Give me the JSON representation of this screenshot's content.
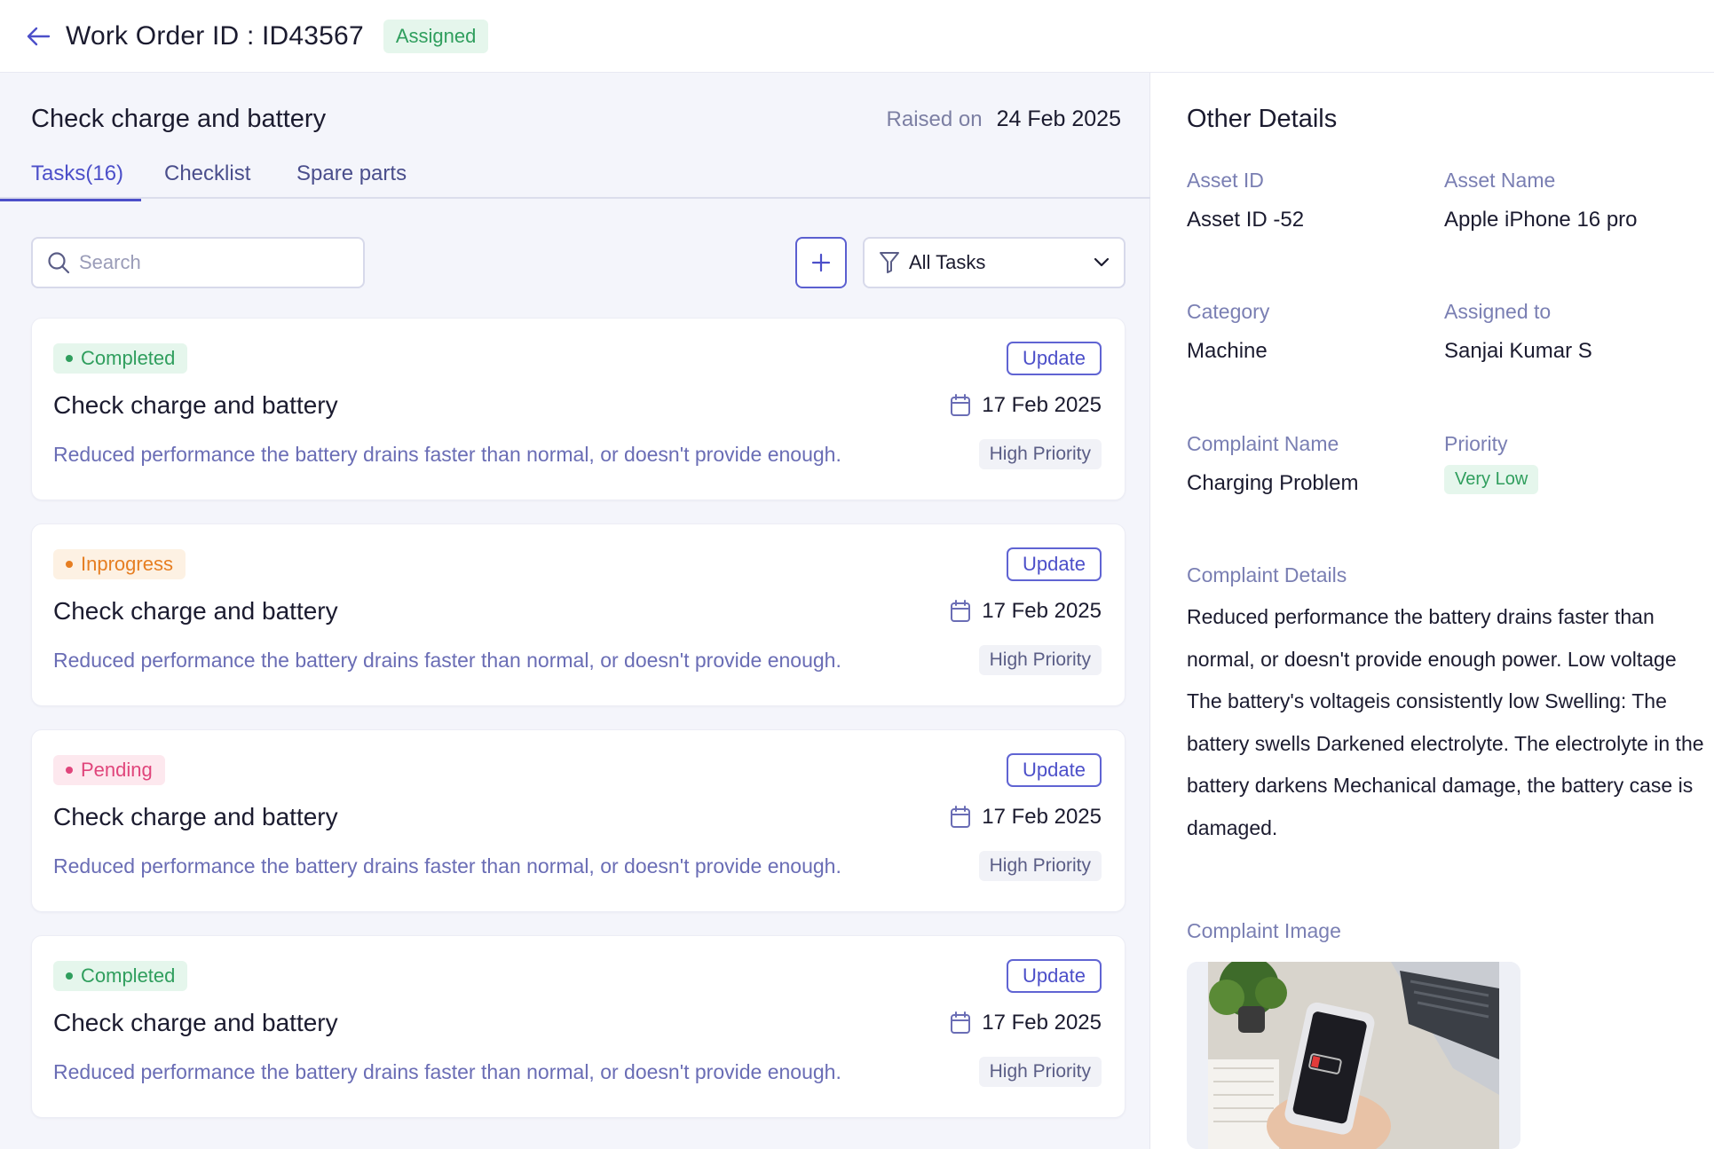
{
  "header": {
    "title": "Work Order ID : ID43567",
    "status": "Assigned"
  },
  "work_order": {
    "title": "Check charge and battery",
    "raised_label": "Raised on",
    "raised_date": "24 Feb 2025"
  },
  "tabs": [
    {
      "label": "Tasks(16)",
      "active": true
    },
    {
      "label": "Checklist",
      "active": false
    },
    {
      "label": "Spare parts",
      "active": false
    }
  ],
  "toolbar": {
    "search_placeholder": "Search",
    "filter_label": "All Tasks"
  },
  "tasks": [
    {
      "status": "Completed",
      "update_label": "Update",
      "title": "Check charge and battery",
      "date": "17 Feb 2025",
      "description": "Reduced performance the battery drains faster than normal, or doesn't provide enough.",
      "priority": "High Priority"
    },
    {
      "status": "Inprogress",
      "update_label": "Update",
      "title": "Check charge and battery",
      "date": "17 Feb 2025",
      "description": "Reduced performance the battery drains faster than normal, or doesn't provide enough.",
      "priority": "High Priority"
    },
    {
      "status": "Pending",
      "update_label": "Update",
      "title": "Check charge and battery",
      "date": "17 Feb 2025",
      "description": "Reduced performance the battery drains faster than normal, or doesn't provide enough.",
      "priority": "High Priority"
    },
    {
      "status": "Completed",
      "update_label": "Update",
      "title": "Check charge and battery",
      "date": "17 Feb 2025",
      "description": "Reduced performance the battery drains faster than normal, or doesn't provide enough.",
      "priority": "High Priority"
    }
  ],
  "other_details": {
    "title": "Other Details",
    "asset_id_label": "Asset ID",
    "asset_id": "Asset ID -52",
    "asset_name_label": "Asset Name",
    "asset_name": "Apple iPhone 16 pro",
    "category_label": "Category",
    "category": "Machine",
    "assigned_label": "Assigned to",
    "assigned_to": "Sanjai Kumar S",
    "complaint_name_label": "Complaint Name",
    "complaint_name": "Charging Problem",
    "priority_label": "Priority",
    "priority": "Very Low",
    "complaint_details_label": "Complaint Details",
    "complaint_details": "Reduced performance the battery drains faster than normal, or doesn't provide enough power. Low voltage The battery's voltageis consistently low Swelling: The battery swells Darkened electrolyte. The electrolyte in the battery darkens Mechanical damage, the battery case is damaged.",
    "complaint_image_label": "Complaint Image"
  },
  "colors": {
    "accent": "#4c4fc9",
    "completed": "#2f9e5d",
    "inprogress": "#e67e22",
    "pending": "#e0457b"
  },
  "icons": [
    "arrow-left-icon",
    "search-icon",
    "plus-icon",
    "filter-icon",
    "chevron-down-icon",
    "calendar-icon"
  ]
}
